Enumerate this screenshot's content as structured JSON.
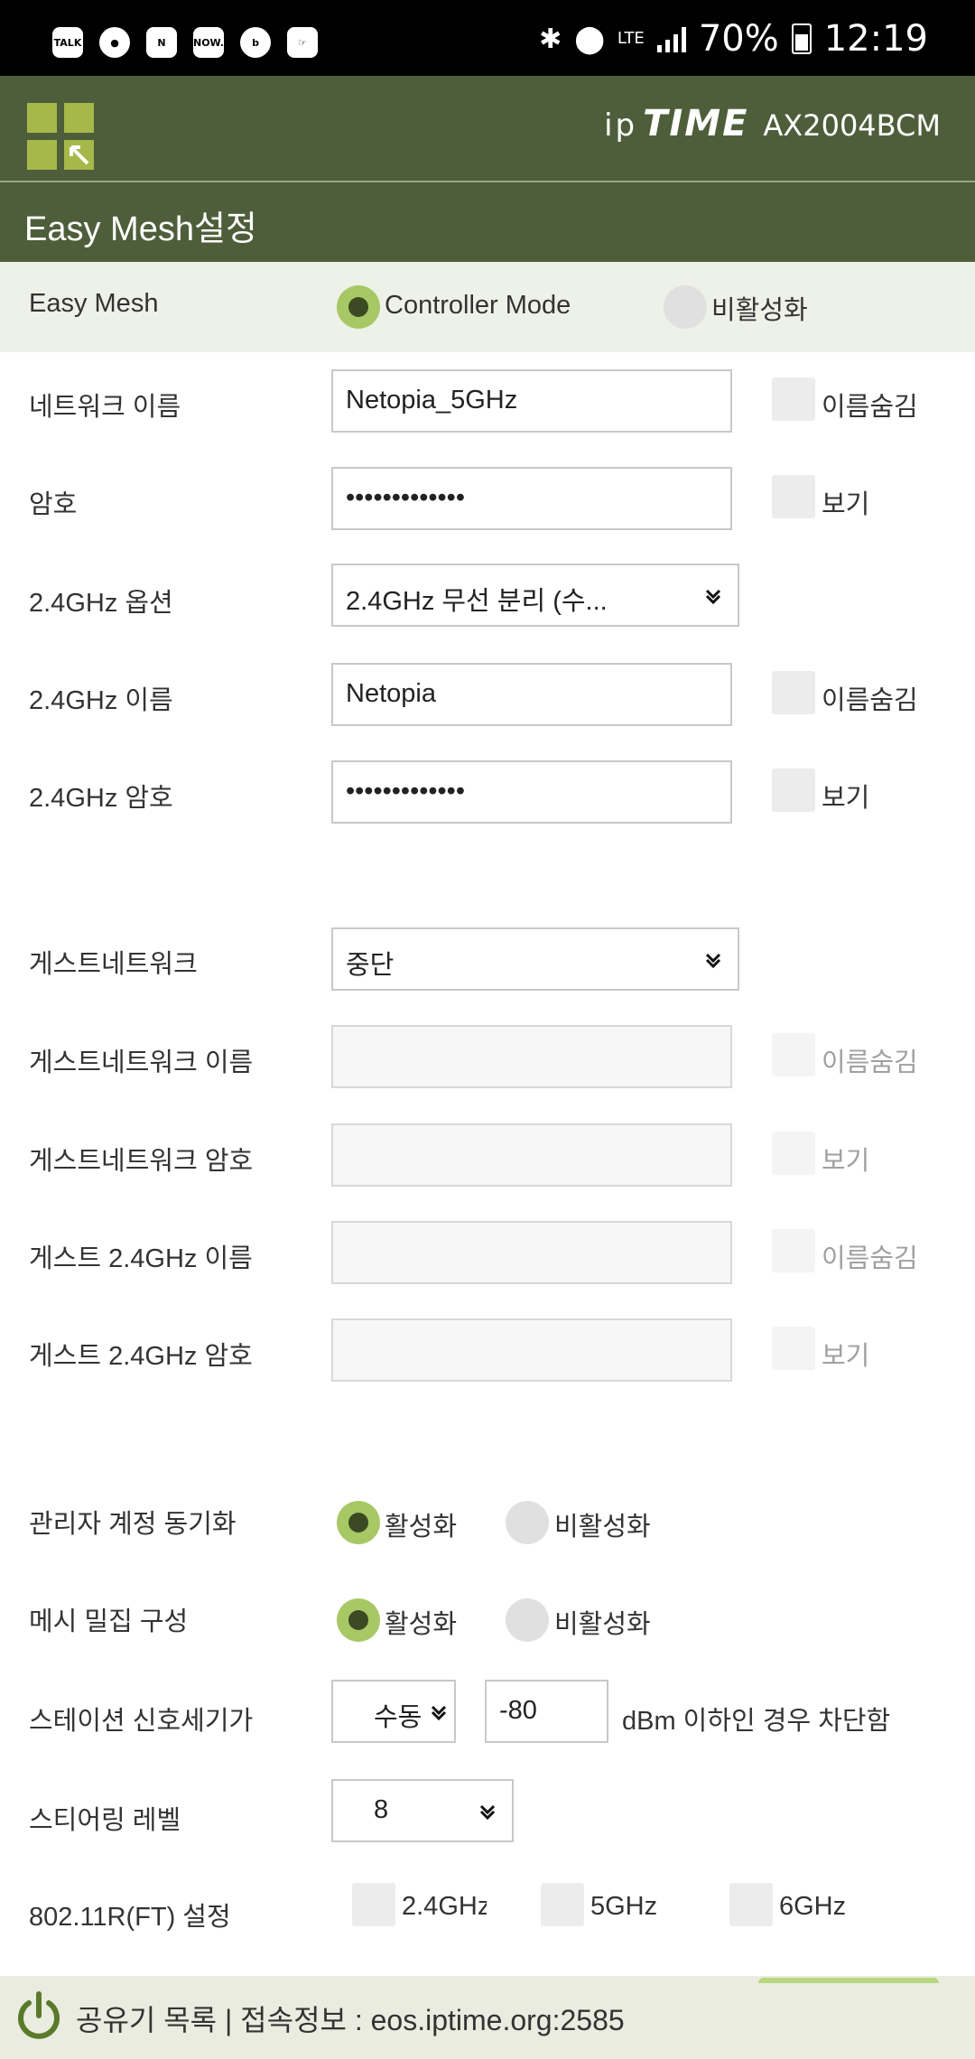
{
  "status_bar": {
    "app_icons": [
      "TALK",
      "●",
      "N",
      "NOW.",
      "b",
      "☞"
    ],
    "network": "LTE",
    "battery": "70%",
    "time": "12:19"
  },
  "header": {
    "brand_prefix": "ip",
    "brand_name": "TIME",
    "model": "AX2004BCM",
    "page_title": "Easy Mesh설정"
  },
  "easy_mesh": {
    "label": "Easy Mesh",
    "option_on": "Controller Mode",
    "option_off": "비활성화"
  },
  "network": {
    "name_label": "네트워크 이름",
    "name_value": "Netopia_5GHz",
    "hide_label": "이름숨김",
    "pw_label": "암호",
    "pw_value": "•••••••••••••",
    "show_label": "보기",
    "opt24_label": "2.4GHz 옵션",
    "opt24_value": "2.4GHz 무선 분리 (수...",
    "name24_label": "2.4GHz 이름",
    "name24_value": "Netopia",
    "pw24_label": "2.4GHz 암호",
    "pw24_value": "•••••••••••••"
  },
  "guest": {
    "label": "게스트네트워크",
    "value": "중단",
    "name_label": "게스트네트워크 이름",
    "pw_label": "게스트네트워크 암호",
    "name24_label": "게스트 2.4GHz 이름",
    "pw24_label": "게스트 2.4GHz 암호",
    "hide_label": "이름숨김",
    "show_label": "보기"
  },
  "advanced": {
    "admin_sync_label": "관리자 계정 동기화",
    "on_label": "활성화",
    "off_label": "비활성화",
    "mesh_dense_label": "메시 밀집 구성",
    "station_label": "스테이션 신호세기가",
    "station_mode": "수동",
    "station_value": "-80",
    "station_suffix": "dBm 이하인 경우 차단함",
    "steering_label": "스티어링 레벨",
    "steering_value": "8",
    "ft_label": "802.11R(FT) 설정",
    "ft_24": "2.4GHz",
    "ft_5": "5GHz",
    "ft_6": "6GHz"
  },
  "footer": {
    "text": "공유기 목록 | 접속정보 : eos.iptime.org:2585"
  }
}
